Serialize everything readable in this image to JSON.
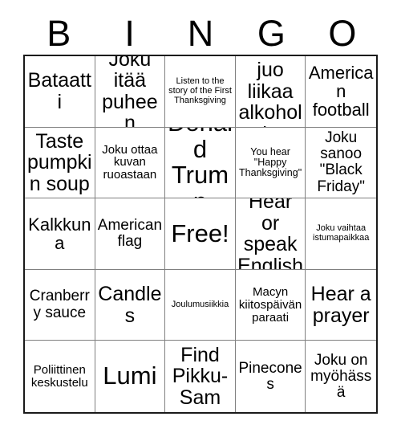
{
  "card": {
    "header": {
      "letters": [
        "B",
        "I",
        "N",
        "G",
        "O"
      ]
    },
    "grid": {
      "columns": 5,
      "rows": 5,
      "free_space_label": "Free!",
      "cells": [
        {
          "text": "Bataatti",
          "size": "fs-xl"
        },
        {
          "text": "Joku itää puheen",
          "size": "fs-xl"
        },
        {
          "text": "Listen to the story of the First Thanksgiving",
          "size": "fs-xxs"
        },
        {
          "text": "Joku juo liikaa alkoholia",
          "size": "fs-xl"
        },
        {
          "text": "American football",
          "size": "fs-lg"
        },
        {
          "text": "Taste pumpkin soup",
          "size": "fs-xl"
        },
        {
          "text": "Joku ottaa kuvan ruoastaan",
          "size": "fs-sm"
        },
        {
          "text": "Donald Trump",
          "size": "fs-xxl"
        },
        {
          "text": "You hear \"Happy Thanksgiving\"",
          "size": "fs-xs"
        },
        {
          "text": "Joku sanoo \"Black Friday\"",
          "size": "fs-md"
        },
        {
          "text": "Kalkkuna",
          "size": "fs-lg"
        },
        {
          "text": "American flag",
          "size": "fs-md"
        },
        {
          "text": "Free!",
          "size": "fs-xxl"
        },
        {
          "text": "Hear or speak English",
          "size": "fs-xl"
        },
        {
          "text": "Joku vaihtaa istumapaikkaa",
          "size": "fs-xxs"
        },
        {
          "text": "Cranberry sauce",
          "size": "fs-md"
        },
        {
          "text": "Candles",
          "size": "fs-xl"
        },
        {
          "text": "Joulumusiikkia",
          "size": "fs-xxs"
        },
        {
          "text": "Macyn kiitospäivän paraati",
          "size": "fs-sm"
        },
        {
          "text": "Hear a prayer",
          "size": "fs-xl"
        },
        {
          "text": "Poliittinen keskustelu",
          "size": "fs-sm"
        },
        {
          "text": "Lumi",
          "size": "fs-xxl"
        },
        {
          "text": "Find Pikku-Sam",
          "size": "fs-xl"
        },
        {
          "text": "Pinecones",
          "size": "fs-md"
        },
        {
          "text": "Joku on myöhässä",
          "size": "fs-md"
        }
      ]
    },
    "colors": {
      "outer_border": "#1a1a1a",
      "inner_border": "#808080",
      "background": "#ffffff",
      "text": "#000000"
    }
  }
}
